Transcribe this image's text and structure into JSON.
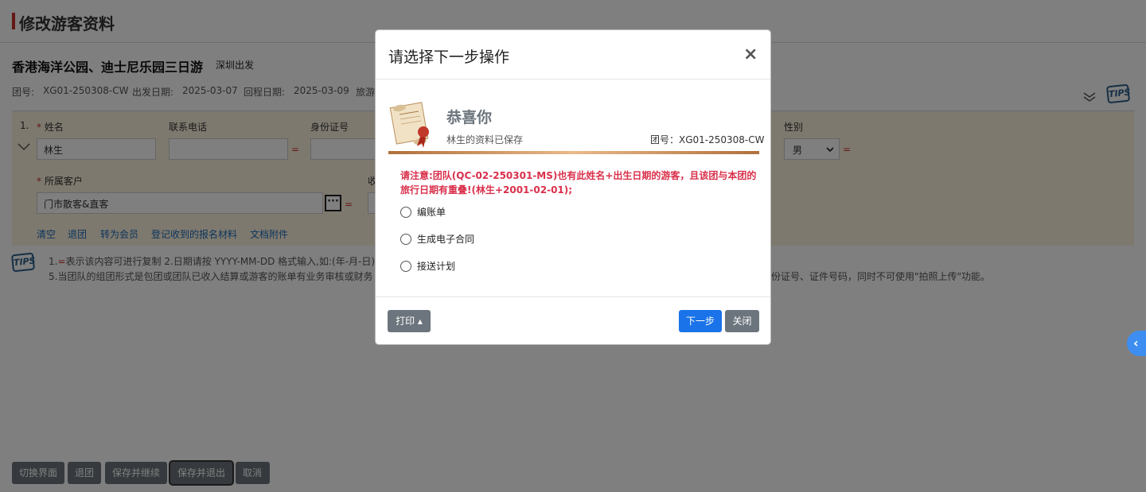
{
  "page": {
    "title": "修改游客资料",
    "tour_name": "香港海洋公园、迪士尼乐园三日游",
    "departure_city": "深圳出发",
    "meta": {
      "group_label": "团号:",
      "group_value": "XG01-250308-CW",
      "depart_label": "出发日期:",
      "depart_value": "2025-03-07",
      "return_label": "回程日期:",
      "return_value": "2025-03-09",
      "more_label": "旅游"
    },
    "tips_label": "TIPS"
  },
  "form": {
    "row_no": "1.",
    "name_label": "姓名",
    "name_value": "林生",
    "phone_label": "联系电话",
    "phone_value": "",
    "id_label": "身份证号",
    "gender_label": "性别",
    "gender_value": "男",
    "customer_label": "所属客户",
    "customer_value": "门市散客&直客",
    "collect_label": "收",
    "required_mark": "*",
    "eq": "=",
    "more_btn": "···",
    "actions": [
      "清空",
      "退团",
      "转为会员",
      "登记收到的报名材料",
      "文档附件"
    ]
  },
  "notes": {
    "line1_a": "1.",
    "line1_eq": "=",
    "line1_b": "表示该内容可进行复制    2.日期请按 YYYY-MM-DD 格式输入,如:(年-月-日)",
    "line2": "5.当团队的组团形式是包团或团队已收入结算或游客的账单有业务审核或财务",
    "line2_right": "份证号、证件号码，同时不可使用\"拍照上传\"功能。"
  },
  "bottom_buttons": [
    "切换界面",
    "退团",
    "保存并继续",
    "保存并退出",
    "取消"
  ],
  "side_tab": "‹",
  "modal": {
    "title": "请选择下一步操作",
    "close": "×",
    "congrats": "恭喜你",
    "saved_text": "林生的资料已保存",
    "group_no": "团号：XG01-250308-CW",
    "warning": "请注意:团队(QC-02-250301-MS)也有此姓名+出生日期的游客，且该团与本团的旅行日期有重叠!(林生+2001-02-01);",
    "options": [
      "编账单",
      "生成电子合同",
      "接送计划"
    ],
    "print_btn": "打印 ▴",
    "next_btn": "下一步",
    "close_btn": "关闭"
  },
  "colors": {
    "primary": "#1a73e8",
    "grey_btn": "#6c757d",
    "warn": "#d9304b"
  }
}
